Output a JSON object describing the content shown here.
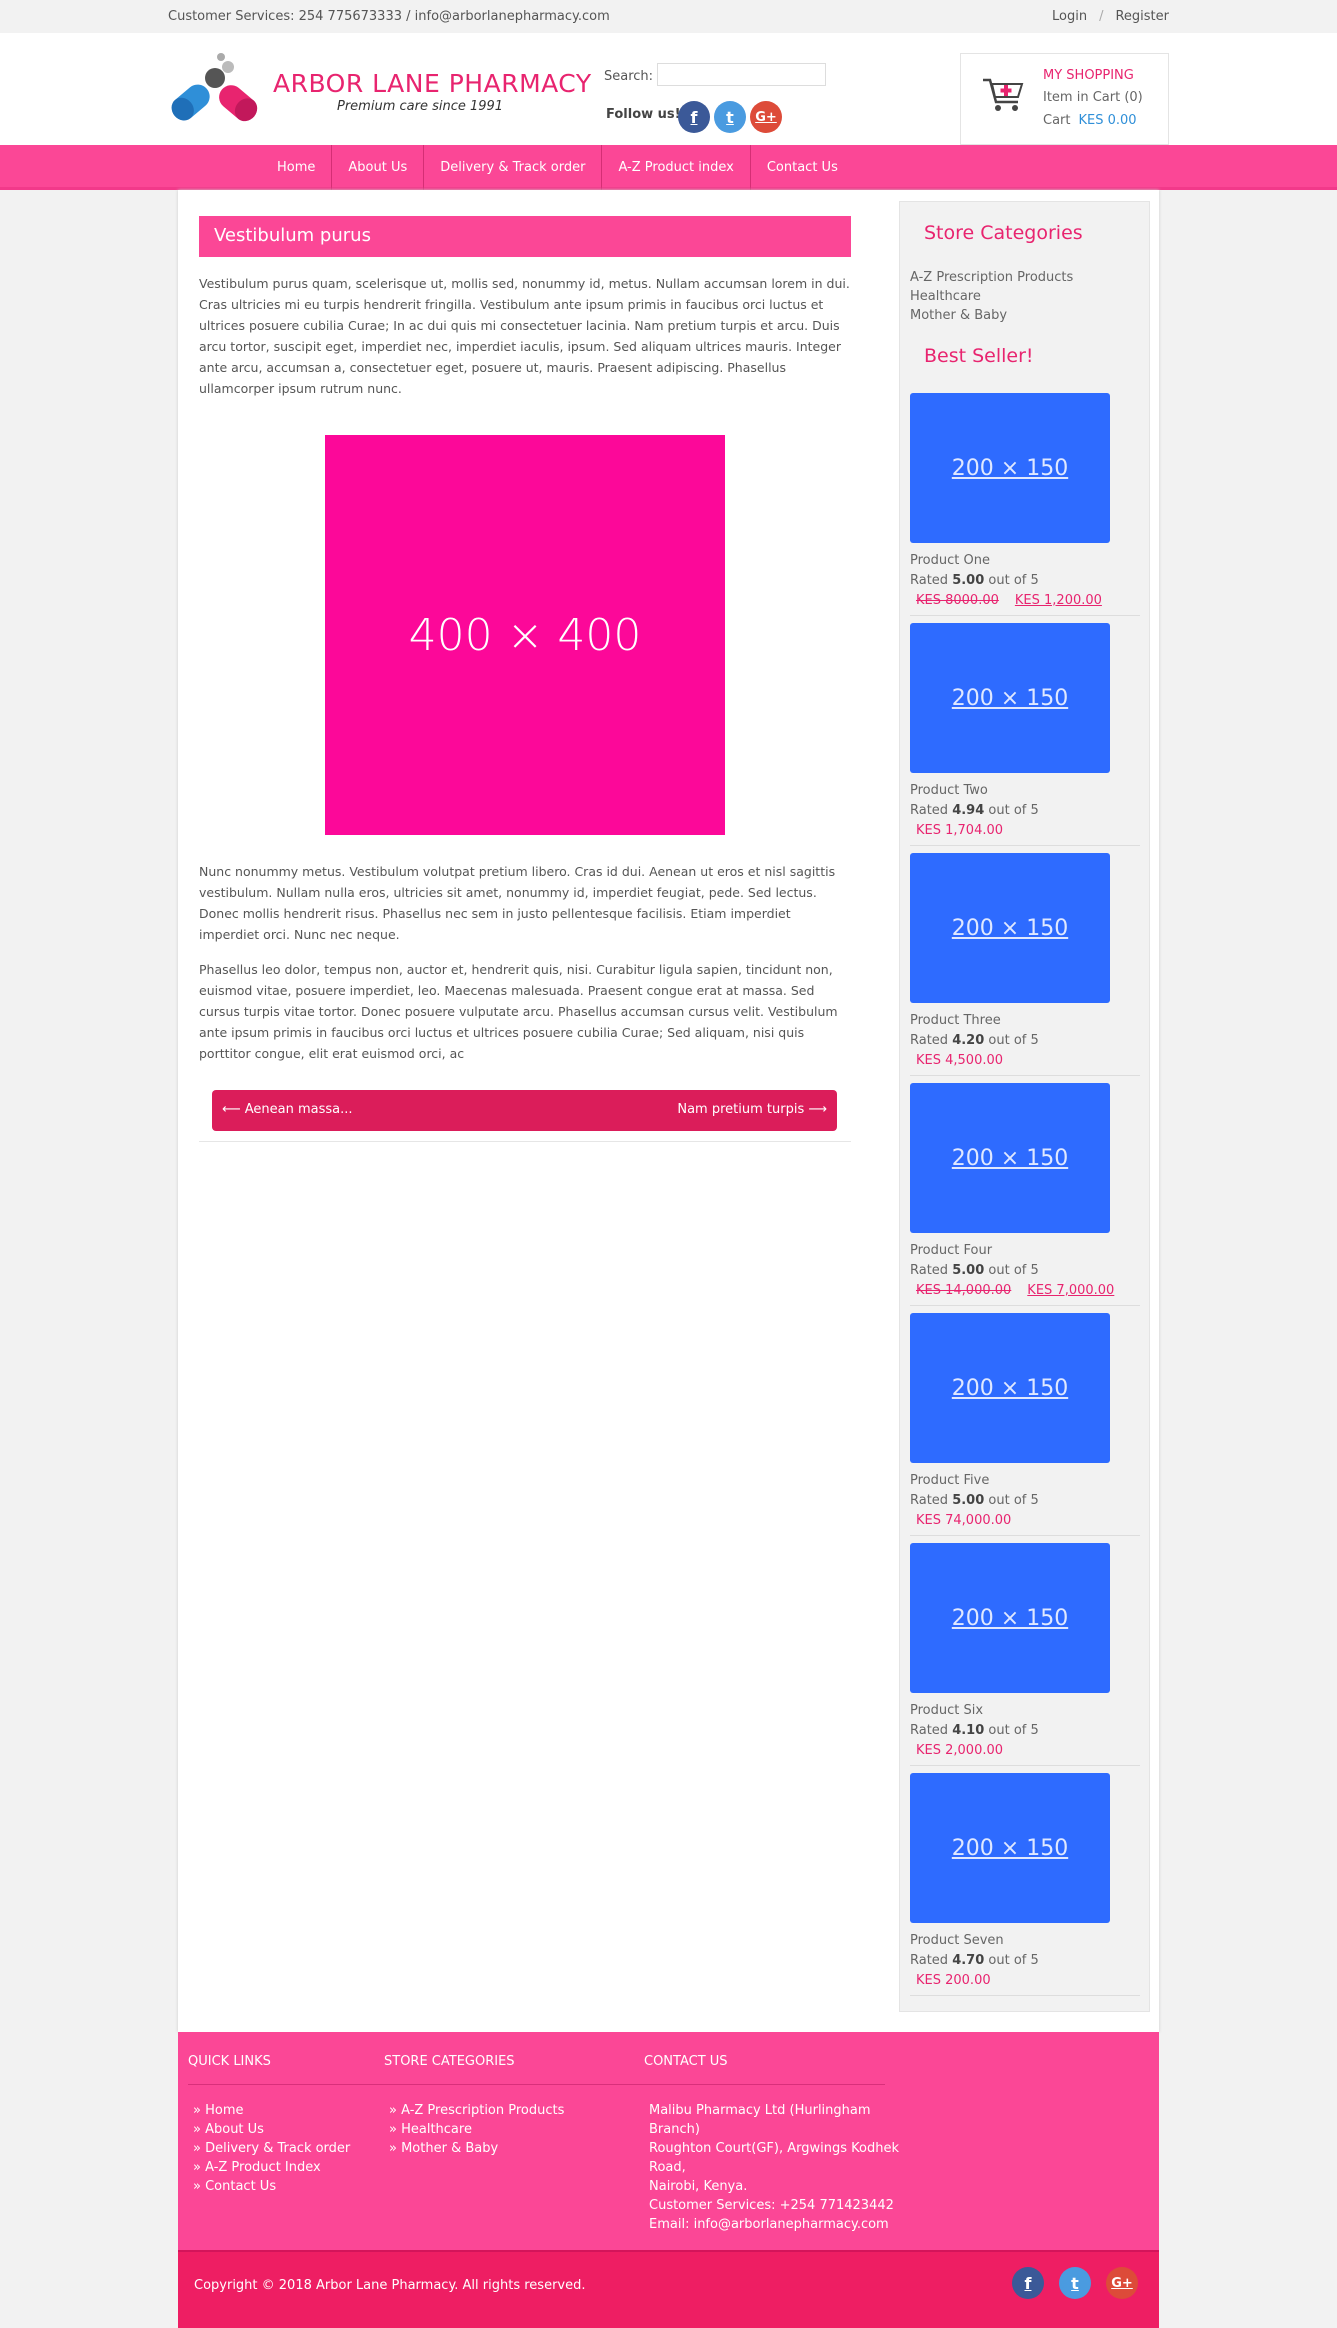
{
  "topbar": {
    "customer_services": "Customer Services: 254 775673333 / info@arborlanepharmacy.com",
    "login": "Login",
    "register": "Register"
  },
  "header": {
    "brand": "ARBOR LANE PHARMACY",
    "tagline": "Premium care since 1991",
    "search_label": "Search:",
    "search_value": "",
    "follow_label": "Follow us!",
    "social": [
      "facebook-icon",
      "twitter-icon",
      "google-plus-icon"
    ],
    "social_glyphs": {
      "facebook": "f",
      "twitter": "t",
      "google": "G+"
    }
  },
  "cart": {
    "title": "MY SHOPPING",
    "items_label": "Item in Cart (0)",
    "cart_label": "Cart",
    "cart_total": "KES 0.00"
  },
  "nav": {
    "items": [
      "Home",
      "About Us",
      "Delivery & Track order",
      "A-Z Product index",
      "Contact Us"
    ]
  },
  "main": {
    "title": "Vestibulum purus",
    "para1": "Vestibulum purus quam, scelerisque ut, mollis sed, nonummy id, metus. Nullam accumsan lorem in dui. Cras ultricies mi eu turpis hendrerit fringilla. Vestibulum ante ipsum primis in faucibus orci luctus et ultrices posuere cubilia Curae; In ac dui quis mi consectetuer lacinia. Nam pretium turpis et arcu. Duis arcu tortor, suscipit eget, imperdiet nec, imperdiet iaculis, ipsum. Sed aliquam ultrices mauris. Integer ante arcu, accumsan a, consectetuer eget, posuere ut, mauris. Praesent adipiscing. Phasellus ullamcorper ipsum rutrum nunc.",
    "hero_image_label": "400 × 400",
    "para2": "Nunc nonummy metus. Vestibulum volutpat pretium libero. Cras id dui. Aenean ut eros et nisl sagittis vestibulum. Nullam nulla eros, ultricies sit amet, nonummy id, imperdiet feugiat, pede. Sed lectus. Donec mollis hendrerit risus. Phasellus nec sem in justo pellentesque facilisis. Etiam imperdiet imperdiet orci. Nunc nec neque.",
    "para3": "Phasellus leo dolor, tempus non, auctor et, hendrerit quis, nisi. Curabitur ligula sapien, tincidunt non, euismod vitae, posuere imperdiet, leo. Maecenas malesuada. Praesent congue erat at massa. Sed cursus turpis vitae tortor. Donec posuere vulputate arcu. Phasellus accumsan cursus velit. Vestibulum ante ipsum primis in faucibus orci luctus et ultrices posuere cubilia Curae; Sed aliquam, nisi quis porttitor congue, elit erat euismod orci, ac",
    "prev_post": "⟵ Aenean massa...",
    "next_post": "Nam pretium turpis ⟶"
  },
  "sidebar": {
    "categories_title": "Store Categories",
    "categories": [
      "A-Z Prescription Products",
      "Healthcare",
      "Mother & Baby"
    ],
    "bestseller_title": "Best Seller!",
    "products": [
      {
        "thumb": "200 × 150",
        "name": "Product One",
        "rated": "Rated",
        "score": "5.00",
        "out_of": "out of 5",
        "old_price": "KES 8000.00",
        "price": "KES 1,200.00"
      },
      {
        "thumb": "200 × 150",
        "name": "Product Two",
        "rated": "Rated",
        "score": "4.94",
        "out_of": "out of 5",
        "old_price": "",
        "price": "KES 1,704.00"
      },
      {
        "thumb": "200 × 150",
        "name": "Product Three",
        "rated": "Rated",
        "score": "4.20",
        "out_of": "out of 5",
        "old_price": "",
        "price": "KES 4,500.00"
      },
      {
        "thumb": "200 × 150",
        "name": "Product Four",
        "rated": "Rated",
        "score": "5.00",
        "out_of": "out of 5",
        "old_price": "KES 14,000.00",
        "price": "KES 7,000.00"
      },
      {
        "thumb": "200 × 150",
        "name": "Product Five",
        "rated": "Rated",
        "score": "5.00",
        "out_of": "out of 5",
        "old_price": "",
        "price": "KES 74,000.00"
      },
      {
        "thumb": "200 × 150",
        "name": "Product Six",
        "rated": "Rated",
        "score": "4.10",
        "out_of": "out of 5",
        "old_price": "",
        "price": "KES 2,000.00"
      },
      {
        "thumb": "200 × 150",
        "name": "Product Seven",
        "rated": "Rated",
        "score": "4.70",
        "out_of": "out of 5",
        "old_price": "",
        "price": "KES 200.00"
      }
    ]
  },
  "footer": {
    "quick_links_title": "QUICK LINKS",
    "quick_links": [
      "Home",
      "About Us",
      "Delivery & Track order",
      "A-Z Product Index",
      "Contact Us"
    ],
    "store_categories_title": "STORE CATEGORIES",
    "store_categories": [
      "A-Z Prescription Products",
      "Healthcare",
      "Mother & Baby"
    ],
    "contact_title": "CONTACT US",
    "contact_lines": [
      "Malibu Pharmacy Ltd (Hurlingham Branch)",
      "Roughton Court(GF), Argwings Kodhek Road,",
      "Nairobi, Kenya.",
      "Customer Services: +254 771423442",
      "Email: info@arborlanepharmacy.com"
    ],
    "copyright": "Copyright © 2018 Arbor Lane Pharmacy. All rights reserved."
  },
  "colors": {
    "accent_pink": "#fb4796",
    "brand_pink": "#e8246f",
    "dark_pink": "#ee1e63",
    "hero_magenta": "#fc0899",
    "thumb_blue": "#2e6bff",
    "link_blue": "#2f8fd8"
  }
}
